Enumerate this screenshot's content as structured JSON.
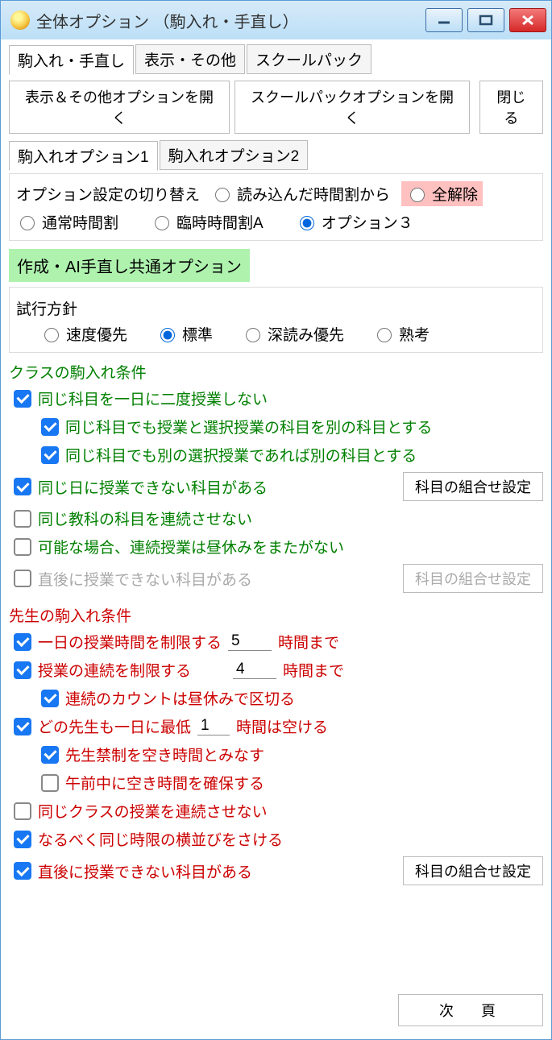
{
  "window": {
    "title": "全体オプション （駒入れ・手直し）"
  },
  "mainTabs": {
    "t0": "駒入れ・手直し",
    "t1": "表示・その他",
    "t2": "スクールパック"
  },
  "toolbar": {
    "b0": "表示＆その他オプションを開く",
    "b1": "スクールパックオプションを開く",
    "b2": "閉じる"
  },
  "subTabs": {
    "s0": "駒入れオプション1",
    "s1": "駒入れオプション2"
  },
  "optSwitch": {
    "label": "オプション設定の切り替え",
    "r0": "読み込んだ時間割から",
    "r1": "全解除",
    "r2": "通常時間割",
    "r3": "臨時時間割A",
    "r4": "オプション３"
  },
  "hl": "作成・AI手直し共通オプション",
  "policy": {
    "label": "試行方針",
    "p0": "速度優先",
    "p1": "標準",
    "p2": "深読み優先",
    "p3": "熟考"
  },
  "classSec": {
    "title": "クラスの駒入れ条件",
    "c0": "同じ科目を一日に二度授業しない",
    "c1": "同じ科目でも授業と選択授業の科目を別の科目とする",
    "c2": "同じ科目でも別の選択授業であれば別の科目とする",
    "c3": "同じ日に授業できない科目がある",
    "c4": "同じ教科の科目を連続させない",
    "c5": "可能な場合、連続授業は昼休みをまたがない",
    "c6": "直後に授業できない科目がある",
    "btn": "科目の組合せ設定"
  },
  "teachSec": {
    "title": "先生の駒入れ条件",
    "t0": "一日の授業時間を制限する",
    "t0v": "5",
    "t0u": "時間まで",
    "t1": "授業の連続を制限する",
    "t1v": "4",
    "t1u": "時間まで",
    "t2": "連続のカウントは昼休みで区切る",
    "t3a": "どの先生も一日に最低",
    "t3v": "1",
    "t3b": "時間は空ける",
    "t4": "先生禁制を空き時間とみなす",
    "t5": "午前中に空き時間を確保する",
    "t6": "同じクラスの授業を連続させない",
    "t7": "なるべく同じ時限の横並びをさける",
    "t8": "直後に授業できない科目がある",
    "btn": "科目の組合せ設定"
  },
  "footer": {
    "next": "次　頁"
  }
}
